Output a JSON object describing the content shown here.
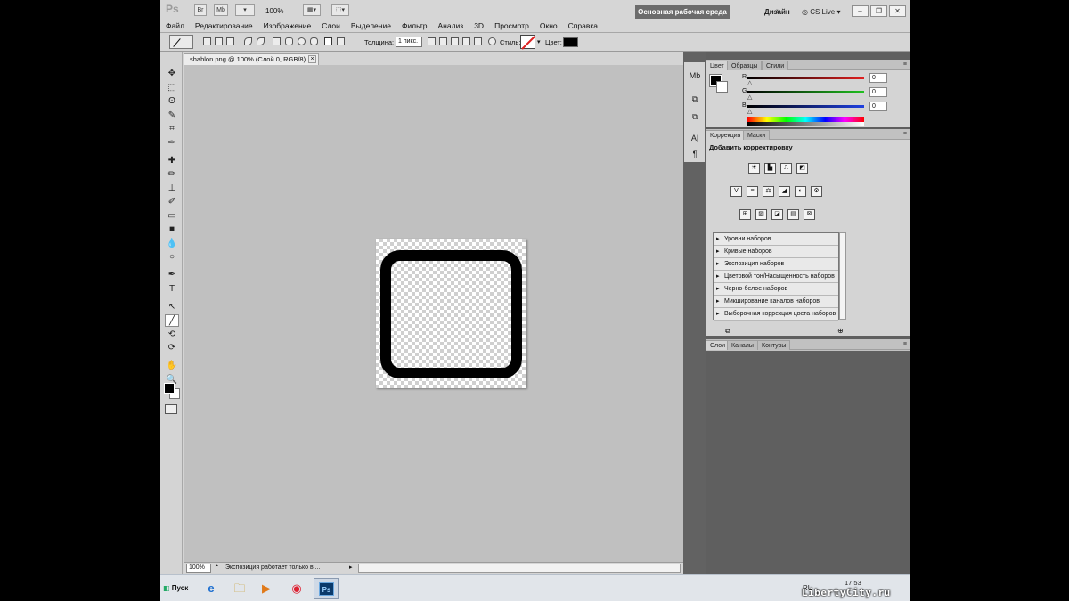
{
  "app": {
    "logo": "Ps",
    "mini_buttons": [
      "Br",
      "Mb",
      "▾"
    ],
    "zoom": "100%",
    "workspace_button": "Основная рабочая среда",
    "design_label": "Дизайн",
    "more": "»",
    "cs_live": "CS Live",
    "window_controls": [
      "–",
      "❐",
      "✕"
    ]
  },
  "menu": [
    "Файл",
    "Редактирование",
    "Изображение",
    "Слои",
    "Выделение",
    "Фильтр",
    "Анализ",
    "3D",
    "Просмотр",
    "Окно",
    "Справка"
  ],
  "options_bar": {
    "thickness_label": "Толщина:",
    "thickness_value": "1 пикс.",
    "style_label": "Стиль:",
    "color_label": "Цвет:",
    "color_value": "#000000"
  },
  "toolbox": {
    "icons": [
      "move-tool",
      "marquee-tool",
      "lasso-tool",
      "quick-select-tool",
      "crop-tool",
      "eyedropper-tool",
      "spot-heal-tool",
      "brush-tool",
      "clone-stamp-tool",
      "history-brush-tool",
      "eraser-tool",
      "gradient-tool",
      "blur-tool",
      "dodge-tool",
      "pen-tool",
      "type-tool",
      "path-select-tool",
      "line-tool",
      "3d-rotate-tool",
      "3d-orbit-tool",
      "hand-tool",
      "zoom-tool"
    ],
    "active": "line-tool",
    "glyphs": [
      "✥",
      "⬚",
      "ʘ",
      "✎",
      "⌗",
      "✑",
      "✚",
      "✏",
      "⊥",
      "✐",
      "▭",
      "■",
      "💧",
      "○",
      "✒",
      "T",
      "↖",
      "╱",
      "⟲",
      "⟳",
      "✋",
      "🔍"
    ],
    "type_label": "T"
  },
  "document": {
    "tab_title": "shablon.png @ 100% (Слой 0, RGB/8)",
    "tab_close": "×"
  },
  "status": {
    "zoom": "100%",
    "text": "Экспозиция работает только в ...",
    "arrow": "▸"
  },
  "icon_strip": {
    "items": [
      "Mb",
      "⧉",
      "⧉",
      "A|",
      "¶"
    ]
  },
  "color_panel": {
    "tabs": [
      "Цвет",
      "Образцы",
      "Стили"
    ],
    "sliders": [
      {
        "label": "R",
        "value": "0",
        "color": "#e02020"
      },
      {
        "label": "G",
        "value": "0",
        "color": "#20c020"
      },
      {
        "label": "B",
        "value": "0",
        "color": "#2040e0"
      }
    ],
    "knob": "△"
  },
  "adjustments_panel": {
    "tabs": [
      "Коррекция",
      "Маски"
    ],
    "title": "Добавить корректировку",
    "row1": [
      "☀",
      "▙",
      "⎍",
      "◩"
    ],
    "row2": [
      "V",
      "≡",
      "⚖",
      "◢",
      "◐",
      "⚙"
    ],
    "row3": [
      "⊞",
      "▨",
      "◪",
      "▤",
      "⊠"
    ],
    "presets": [
      "Уровни наборов",
      "Кривые наборов",
      "Экспозиция наборов",
      "Цветовой тон/Насыщенность наборов",
      "Черно-белое наборов",
      "Микширование каналов наборов",
      "Выборочная коррекция цвета наборов"
    ],
    "foot_left": "⧉",
    "foot_right": "⊕"
  },
  "layers_panel": {
    "tabs": [
      "Слои",
      "Каналы",
      "Контуры"
    ]
  },
  "taskbar": {
    "start": "Пуск",
    "icons": [
      "ie-icon",
      "explorer-icon",
      "media-player-icon",
      "chrome-icon"
    ],
    "icon_glyphs": [
      "e",
      "🗀",
      "▶",
      "◉"
    ],
    "ps_label": "Ps",
    "lang": "RU",
    "time": "17:53",
    "watermark": "LibertyCity.ru"
  }
}
